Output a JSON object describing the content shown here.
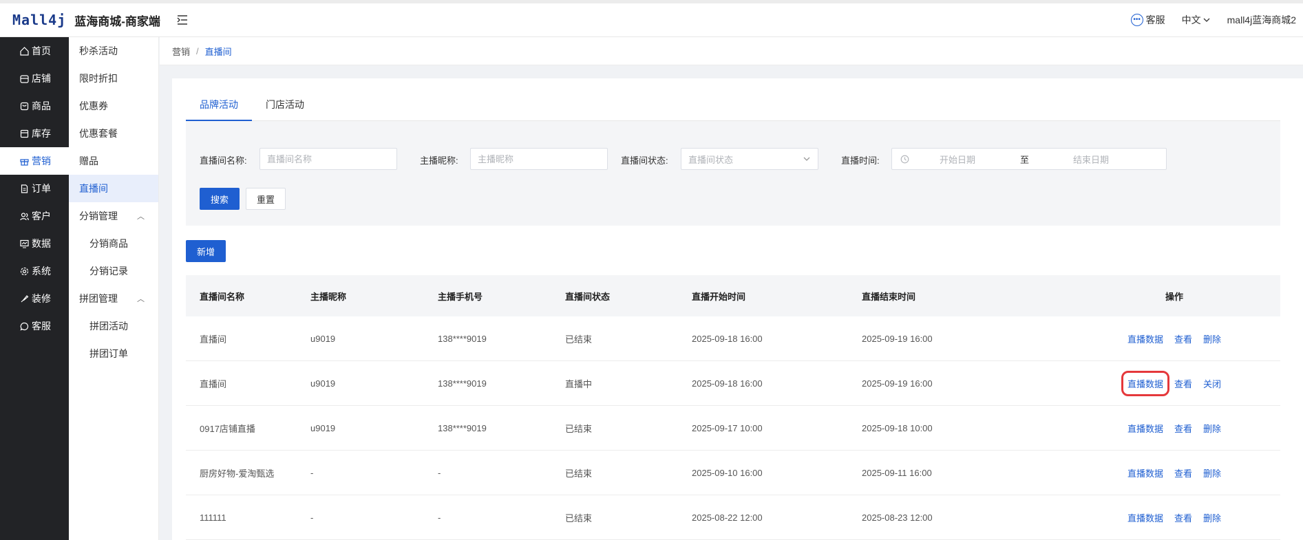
{
  "topbar": {
    "logo_mark": "Mall4j",
    "app_name": "蓝海商城-商家端",
    "service_label": "客服",
    "language_label": "中文",
    "user_label": "mall4j蓝海商城2"
  },
  "sidebar": {
    "items": [
      {
        "label": "首页",
        "icon": "home-icon"
      },
      {
        "label": "店铺",
        "icon": "shop-icon"
      },
      {
        "label": "商品",
        "icon": "bag-icon"
      },
      {
        "label": "库存",
        "icon": "box-icon"
      },
      {
        "label": "营销",
        "icon": "gift-icon"
      },
      {
        "label": "订单",
        "icon": "document-icon"
      },
      {
        "label": "客户",
        "icon": "users-icon"
      },
      {
        "label": "数据",
        "icon": "chart-icon"
      },
      {
        "label": "系统",
        "icon": "settings-icon"
      },
      {
        "label": "装修",
        "icon": "brush-icon"
      },
      {
        "label": "客服",
        "icon": "chat-icon"
      }
    ]
  },
  "subsidebar": {
    "items": [
      {
        "label": "秒杀活动"
      },
      {
        "label": "限时折扣"
      },
      {
        "label": "优惠券"
      },
      {
        "label": "优惠套餐"
      },
      {
        "label": "赠品"
      },
      {
        "label": "直播间"
      },
      {
        "label": "分销管理"
      },
      {
        "label": "分销商品"
      },
      {
        "label": "分销记录"
      },
      {
        "label": "拼团管理"
      },
      {
        "label": "拼团活动"
      },
      {
        "label": "拼团订单"
      }
    ]
  },
  "breadcrumb": {
    "parent": "营销",
    "separator": "/",
    "current": "直播间"
  },
  "tabs": [
    {
      "label": "品牌活动"
    },
    {
      "label": "门店活动"
    }
  ],
  "filter": {
    "name_label": "直播间名称:",
    "name_placeholder": "直播间名称",
    "anchor_label": "主播昵称:",
    "anchor_placeholder": "主播昵称",
    "status_label": "直播间状态:",
    "status_placeholder": "直播间状态",
    "time_label": "直播时间:",
    "start_placeholder": "开始日期",
    "range_sep": "至",
    "end_placeholder": "结束日期",
    "search_button": "搜索",
    "reset_button": "重置"
  },
  "add_button": "新增",
  "table": {
    "headers": [
      "直播间名称",
      "主播昵称",
      "主播手机号",
      "直播间状态",
      "直播开始时间",
      "直播结束时间",
      "操作"
    ],
    "rows": [
      {
        "name": "直播间",
        "anchor": "u9019",
        "phone": "138****9019",
        "status": "已结束",
        "start": "2025-09-18 16:00",
        "end": "2025-09-19 16:00",
        "a1": "直播数据",
        "a2": "查看",
        "a3": "删除"
      },
      {
        "name": "直播间",
        "anchor": "u9019",
        "phone": "138****9019",
        "status": "直播中",
        "start": "2025-09-18 16:00",
        "end": "2025-09-19 16:00",
        "a1": "直播数据",
        "a2": "查看",
        "a3": "关闭"
      },
      {
        "name": "0917店铺直播",
        "anchor": "u9019",
        "phone": "138****9019",
        "status": "已结束",
        "start": "2025-09-17 10:00",
        "end": "2025-09-18 10:00",
        "a1": "直播数据",
        "a2": "查看",
        "a3": "删除"
      },
      {
        "name": "厨房好物-爱淘甄选",
        "anchor": "-",
        "phone": "-",
        "status": "已结束",
        "start": "2025-09-10 16:00",
        "end": "2025-09-11 16:00",
        "a1": "直播数据",
        "a2": "查看",
        "a3": "删除"
      },
      {
        "name": "111111",
        "anchor": "-",
        "phone": "-",
        "status": "已结束",
        "start": "2025-08-22 12:00",
        "end": "2025-08-23 12:00",
        "a1": "直播数据",
        "a2": "查看",
        "a3": "删除"
      }
    ]
  },
  "colors": {
    "primary": "#1f5fd1",
    "sidebar_bg": "#222326",
    "highlight": "#e5383b"
  }
}
